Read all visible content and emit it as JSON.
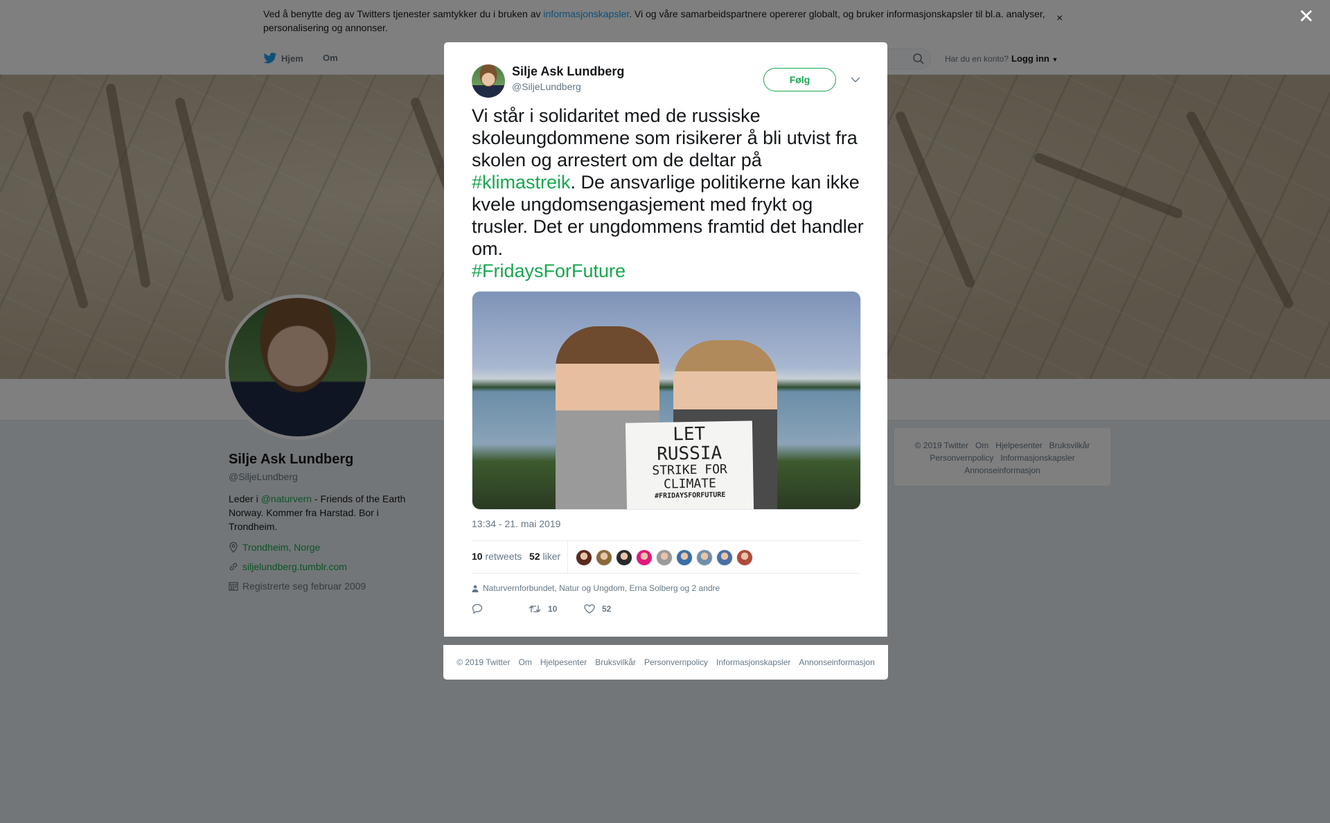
{
  "cookie": {
    "text_before": "Ved å benytte deg av Twitters tjenester samtykker du i bruken av ",
    "link": "informasjonskapsler",
    "text_after": ". Vi og våre samarbeidspartnere opererer globalt, og bruker informasjonskapsler til bl.a. analyser, personalisering og annonser.",
    "close": "×"
  },
  "nav": {
    "home": "Hjem",
    "about": "Om",
    "account_prompt": "Har du en konto?",
    "login": "Logg inn"
  },
  "profile": {
    "name": "Silje Ask Lundberg",
    "handle": "@SiljeLundberg",
    "bio_before": "Leder i ",
    "bio_mention": "@naturvern",
    "bio_after": " - Friends of the Earth Norway. Kommer fra Harstad. Bor i Trondheim.",
    "location": "Trondheim, Norge",
    "website": "siljelundberg.tumblr.com",
    "joined": "Registrerte seg februar 2009"
  },
  "side_footer": {
    "line1": [
      "© 2019 Twitter",
      "Om",
      "Hjelpesenter",
      "Bruksvilkår"
    ],
    "line2": [
      "Personvernpolicy",
      "Informasjonskapsler"
    ],
    "line3": [
      "Annonseinformasjon"
    ]
  },
  "overlay": {
    "close": "✕"
  },
  "tweet": {
    "name": "Silje Ask Lundberg",
    "handle": "@SiljeLundberg",
    "follow": "Følg",
    "text_1": "Vi står i solidaritet med de russiske skoleungdommene som risikerer å bli utvist fra skolen og arrestert om de deltar på ",
    "hashtag_1": "#klimastreik",
    "text_2": ". De ansvarlige politikerne kan ikke kvele ungdomsengasjement med frykt og trusler. Det er ungdommens framtid det handler om.",
    "hashtag_2": "#FridaysForFuture",
    "sign": {
      "l1": "LET",
      "l2": "RUSSIA",
      "l3": "STRIKE FOR CLIMATE",
      "l4": "#FRIDAYSFORFUTURE"
    },
    "time": "13:34 - 21. mai 2019",
    "retweets_count": "10",
    "retweets_label": "retweets",
    "likes_count": "52",
    "likes_label": "liker",
    "liker_colors": [
      "#5a2a1e",
      "#8a6a3a",
      "#2a2a2a",
      "#e0197d",
      "#9a9a9a",
      "#3b6ea5",
      "#6f8fa8",
      "#4a6fa5",
      "#b04a3a"
    ],
    "social_context": "Naturvernforbundet, Natur og Ungdom, Erna Solberg og 2 andre",
    "action_retweet_count": "10",
    "action_like_count": "52"
  },
  "modal_footer": [
    "© 2019 Twitter",
    "Om",
    "Hjelpesenter",
    "Bruksvilkår",
    "Personvernpolicy",
    "Informasjonskapsler",
    "Annonseinformasjon"
  ],
  "colors": {
    "twitter_blue": "#1da1f2",
    "accent_green": "#17a74f"
  }
}
